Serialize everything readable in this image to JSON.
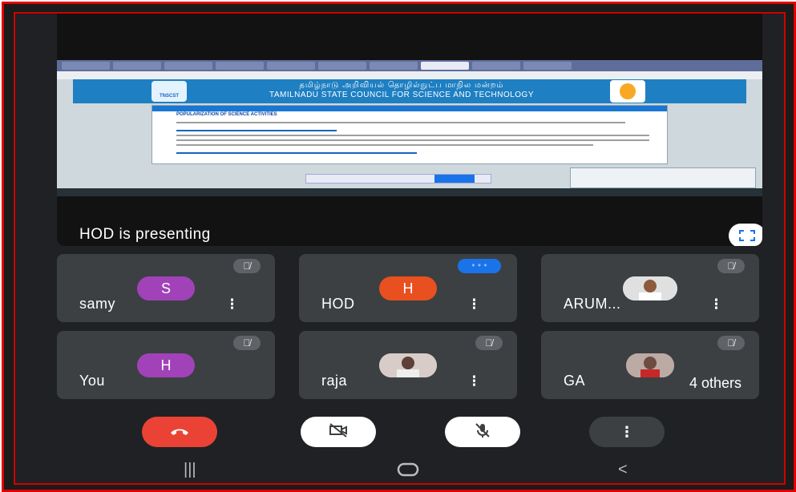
{
  "shared_screen": {
    "tamil_title": "தமிழ்நாடு அறிவியல் தொழில்நுட்ப மாநில மன்றம்",
    "english_title": "TAMILNADU STATE COUNCIL FOR SCIENCE AND TECHNOLOGY",
    "section_title": "POPULARIZATION OF SCIENCE ACTIVITIES",
    "logo_text": "TNSCST"
  },
  "presenting_text": "HOD is presenting",
  "fullscreen_icon": "fullscreen-icon",
  "participants": [
    {
      "name": "samy",
      "initial": "S",
      "avatar_color": "#a142b8",
      "muted": true
    },
    {
      "name": "HOD",
      "initial": "H",
      "avatar_color": "#e8501f",
      "speaking": true
    },
    {
      "name": "ARUM...",
      "initial": "",
      "photo": true,
      "muted": true
    },
    {
      "name": "You",
      "initial": "H",
      "avatar_color": "#a142b8",
      "muted": true
    },
    {
      "name": "raja",
      "initial": "",
      "photo": true,
      "muted": true
    },
    {
      "name": "GA",
      "initial": "",
      "photo": true,
      "muted": true
    }
  ],
  "others_label": "4 others",
  "controls": {
    "end_call_icon": "end-call-icon",
    "camera_off_icon": "camera-off-icon",
    "mic_off_icon": "mic-off-icon",
    "more_icon": "more-options-icon",
    "end_call_color": "#ea4335"
  },
  "nav": {
    "recents_icon": "recents-icon",
    "home_icon": "home-icon",
    "back_icon": "back-icon"
  }
}
